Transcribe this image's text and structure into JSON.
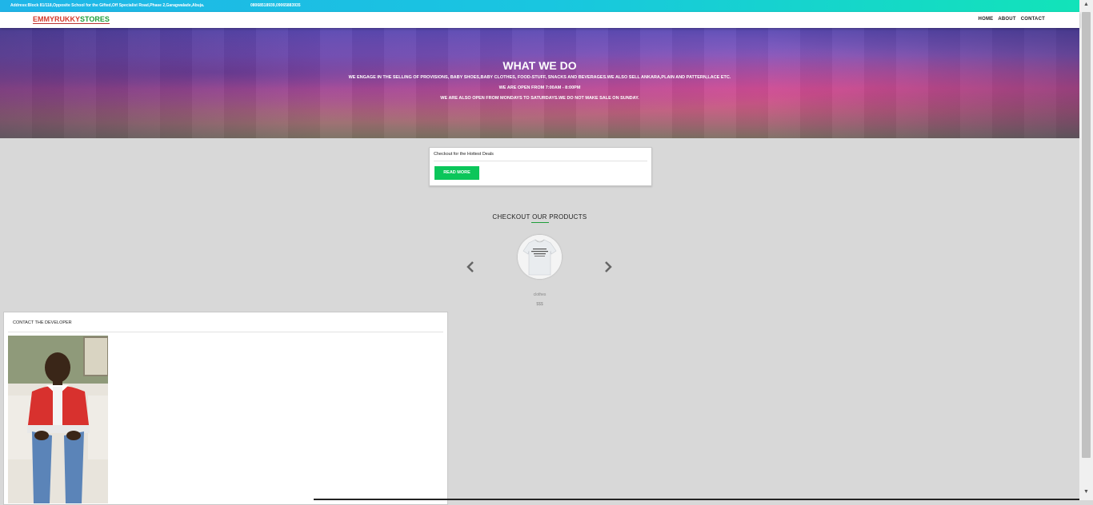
{
  "topbar": {
    "address": "Address:Block 81/118,Opposite School for the Gifted,Off Specialist Road,Phase 2,Garagwalade,Abuja.",
    "phones": "08068518939,09065883935"
  },
  "brand": {
    "part1": "EMMYRUKKY",
    "part2": "STORES"
  },
  "nav": {
    "home": "HOME",
    "about": "ABOUT",
    "contact": "CONTACT"
  },
  "hero": {
    "title": "WHAT WE DO",
    "line1": "WE ENGAGE IN THE SELLING OF PROVISIONS, BABY SHOES,BABY CLOTHES, FOOD-STUFF, SNACKS AND BEVERAGES.WE ALSO SELL ANKARA,PLAIN AND PATTERN,LACE ETC.",
    "line2": "WE ARE OPEN FROM 7:00AM - 8:00PM",
    "line3": "WE ARE ALSO OPEN FROM MONDAYS TO SATURDAYS.WE DO NOT MAKE SALE ON SUNDAY."
  },
  "deals": {
    "title": "Checkout for the Hottest Deals",
    "button": "READ MORE"
  },
  "products": {
    "heading": "CHECKOUT OUR PRODUCTS",
    "prev_icon": "chevron-left-icon",
    "next_icon": "chevron-right-icon",
    "item": {
      "name": "clothes",
      "price": "$$$"
    }
  },
  "contact_card": {
    "title": "CONTACT THE DEVELOPER"
  },
  "colors": {
    "accent_green": "#0bc65a",
    "brand_red": "#d33a2c",
    "brand_green": "#1e9e3a",
    "topbar_start": "#1fb5e8",
    "topbar_end": "#12e4b8"
  }
}
